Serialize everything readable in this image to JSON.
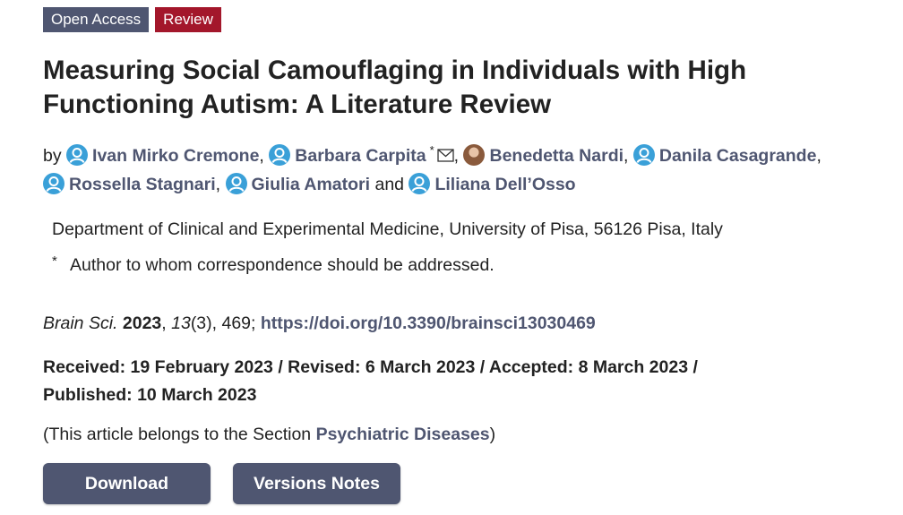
{
  "badges": {
    "open_access": "Open Access",
    "review": "Review"
  },
  "title": "Measuring Social Camouflaging in Individuals with High Functioning Autism: A Literature Review",
  "authors": {
    "by": "by",
    "list": [
      "Ivan Mirko Cremone",
      "Barbara Carpita",
      "Benedetta Nardi",
      "Danila Casagrande",
      "Rossella Stagnari",
      "Giulia Amatori",
      "Liliana Dell’Osso"
    ],
    "corresponding_mark": "*",
    "and": "and"
  },
  "affiliation": "Department of Clinical and Experimental Medicine, University of Pisa, 56126 Pisa, Italy",
  "correspondence": {
    "mark": "*",
    "text": "Author to whom correspondence should be addressed."
  },
  "citation": {
    "journal": "Brain Sci.",
    "year": "2023",
    "volume": "13",
    "issue_pages": "(3), 469;",
    "doi": "https://doi.org/10.3390/brainsci13030469"
  },
  "dates": {
    "line1": "Received: 19 February 2023 / Revised: 6 March 2023 / Accepted: 8 March 2023 /",
    "line2": "Published: 10 March 2023"
  },
  "section_note": {
    "prefix": "(This article belongs to the Section ",
    "section": "Psychiatric Diseases",
    "suffix": ")"
  },
  "buttons": {
    "download": "Download",
    "versions": "Versions Notes"
  },
  "colors": {
    "accent": "#4f5671",
    "review_badge": "#a3172b",
    "author_icon": "#3aa0d8"
  }
}
